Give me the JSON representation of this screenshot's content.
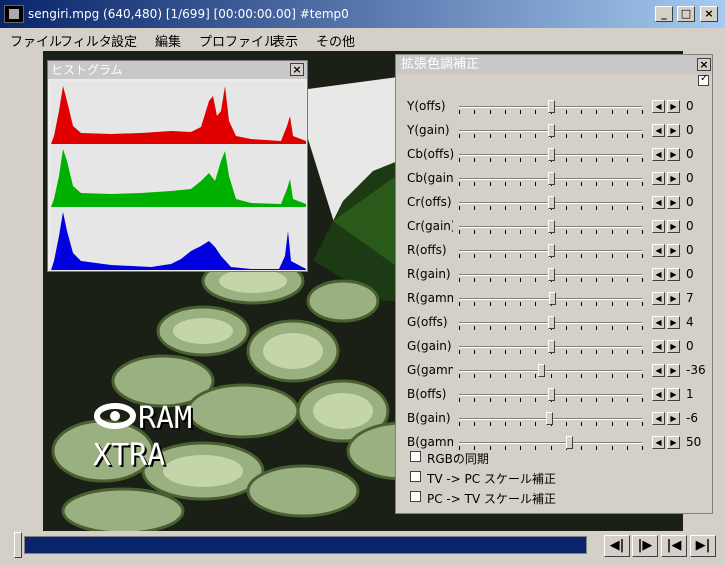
{
  "window": {
    "title": "sengiri.mpg (640,480)  [1/699] [00:00:00.00]  #temp0"
  },
  "menu": [
    "ファイル",
    "フィルタ",
    "設定",
    "編集",
    "プロファイル",
    "表示",
    "その他"
  ],
  "video": {
    "overlay_line1": "RAM",
    "overlay_line2": "XTRA"
  },
  "histogram": {
    "title": "ヒストグラム",
    "colors": [
      "#e00000",
      "#00b000",
      "#0000e0"
    ]
  },
  "color_panel": {
    "title": "拡張色調補正",
    "rows": [
      {
        "label": "Y(offs)",
        "value": "0",
        "level": 0.5
      },
      {
        "label": "Y(gain)",
        "value": "0",
        "level": 0.5
      },
      {
        "label": "Cb(offs)",
        "value": "0",
        "level": 0.5
      },
      {
        "label": "Cb(gain)",
        "value": "0",
        "level": 0.5
      },
      {
        "label": "Cr(offs)",
        "value": "0",
        "level": 0.5
      },
      {
        "label": "Cr(gain)",
        "value": "0",
        "level": 0.5
      },
      {
        "label": "R(offs)",
        "value": "0",
        "level": 0.5
      },
      {
        "label": "R(gain)",
        "value": "0",
        "level": 0.5
      },
      {
        "label": "R(gamma)",
        "value": "7",
        "level": 0.51
      },
      {
        "label": "G(offs)",
        "value": "4",
        "level": 0.505
      },
      {
        "label": "G(gain)",
        "value": "0",
        "level": 0.5
      },
      {
        "label": "G(gamma)",
        "value": "-36",
        "level": 0.45
      },
      {
        "label": "B(offs)",
        "value": "1",
        "level": 0.502
      },
      {
        "label": "B(gain)",
        "value": "-6",
        "level": 0.49
      },
      {
        "label": "B(gamma)",
        "value": "50",
        "level": 0.6
      }
    ],
    "checkboxes": [
      {
        "label": "RGBの同期",
        "checked": false
      },
      {
        "label": "TV -> PC スケール補正",
        "checked": false
      },
      {
        "label": "PC -> TV スケール補正",
        "checked": false
      }
    ]
  },
  "seek": {
    "position": 0.0
  }
}
